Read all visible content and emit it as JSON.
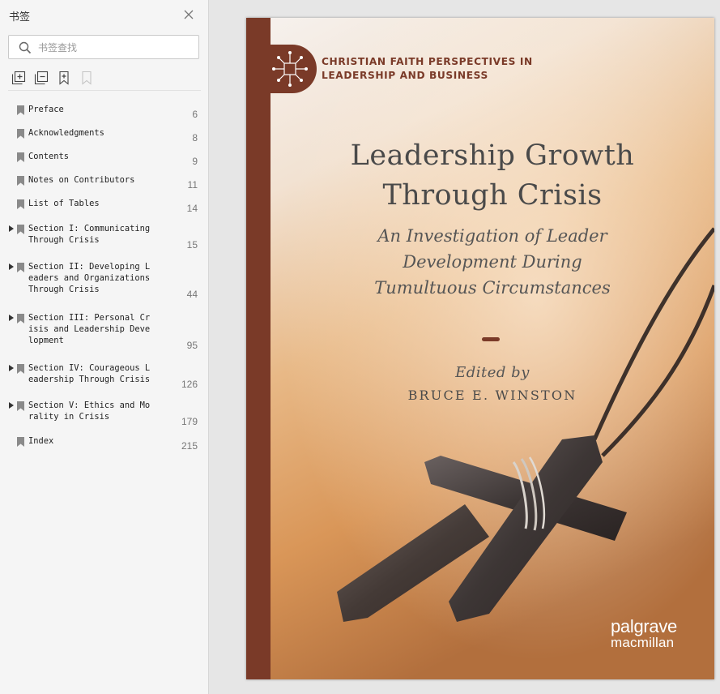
{
  "sidebar": {
    "title": "书签",
    "search_placeholder": "书签查找",
    "bookmarks": [
      {
        "label": "Preface",
        "page": "6",
        "expandable": false
      },
      {
        "label": "Acknowledgments",
        "page": "8",
        "expandable": false
      },
      {
        "label": "Contents",
        "page": "9",
        "expandable": false
      },
      {
        "label": "Notes on Contributors",
        "page": "11",
        "expandable": false
      },
      {
        "label": "List of Tables",
        "page": "14",
        "expandable": false
      },
      {
        "label": "Section I: Communicating\nThrough Crisis",
        "page": "15",
        "expandable": true
      },
      {
        "label": "Section II: Developing L\neaders and Organizations\nThrough Crisis",
        "page": "44",
        "expandable": true
      },
      {
        "label": "Section III: Personal Cr\nisis and Leadership Deve\nlopment",
        "page": "95",
        "expandable": true
      },
      {
        "label": "Section IV: Courageous L\neadership Through Crisis",
        "page": "126",
        "expandable": true
      },
      {
        "label": "Section V: Ethics and Mo\nrality in Crisis",
        "page": "179",
        "expandable": true
      },
      {
        "label": "Index",
        "page": "215",
        "expandable": false
      }
    ]
  },
  "cover": {
    "series_line1": "CHRISTIAN FAITH PERSPECTIVES IN",
    "series_line2": "LEADERSHIP AND BUSINESS",
    "title_line1": "Leadership Growth",
    "title_line2": "Through Crisis",
    "subtitle_line1": "An Investigation of Leader",
    "subtitle_line2": "Development During",
    "subtitle_line3": "Tumultuous Circumstances",
    "edited_by": "Edited by",
    "editor": "BRUCE E. WINSTON",
    "publisher_line1": "palgrave",
    "publisher_line2": "macmillan",
    "accent_color": "#7a3a28"
  }
}
